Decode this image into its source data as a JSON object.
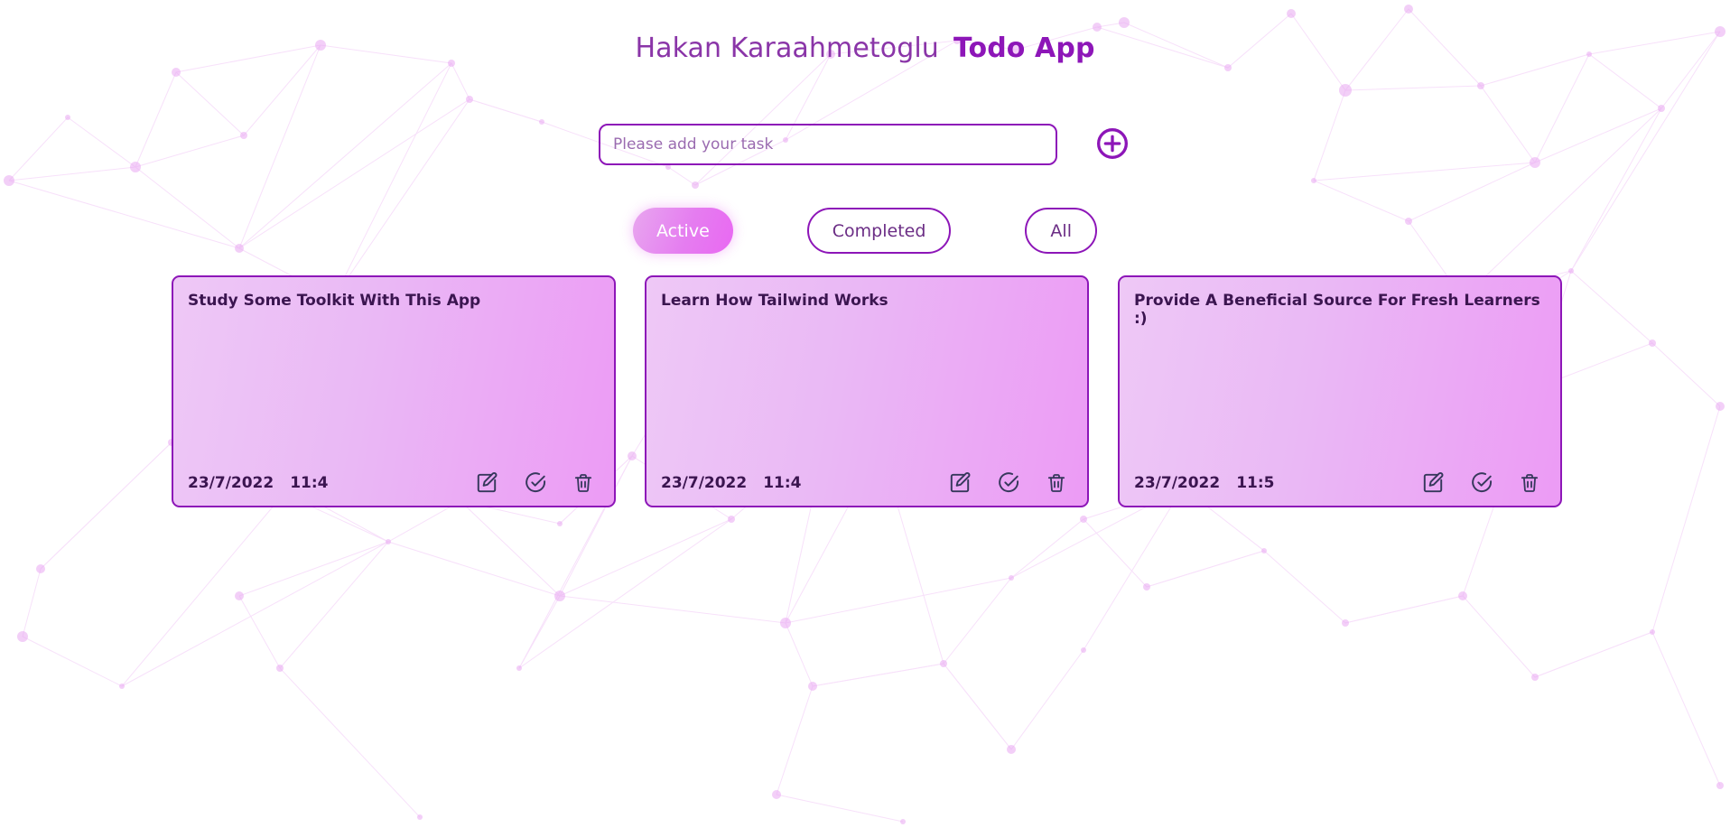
{
  "header": {
    "author": "Hakan Karaahmetoglu",
    "app_title": "Todo App"
  },
  "add_task": {
    "placeholder": "Please add your task",
    "value": "",
    "add_button_label": "add-task"
  },
  "filters": {
    "active_filter": "Active",
    "items": [
      {
        "label": "Active",
        "selected": true
      },
      {
        "label": "Completed",
        "selected": false
      },
      {
        "label": "All",
        "selected": false
      }
    ]
  },
  "todos": [
    {
      "title": "Study Some Toolkit With This App",
      "date": "23/7/2022",
      "time": "11:4"
    },
    {
      "title": "Learn How Tailwind Works",
      "date": "23/7/2022",
      "time": "11:4"
    },
    {
      "title": "Provide A Beneficial Source For Fresh Learners :)",
      "date": "23/7/2022",
      "time": "11:5"
    }
  ],
  "colors": {
    "brand_purple": "#8d16b8",
    "author_purple": "#8a35a8",
    "card_gradient_start": "#eec8f6",
    "card_gradient_end": "#ec9bf5",
    "card_text": "#3b1550",
    "icon_navy": "#36385c",
    "active_pill_start": "#e8a6ef",
    "active_pill_end": "#e968f2",
    "background": "#ffffff",
    "network_node": "#e9a8f2"
  },
  "icons": {
    "add": "plus-circle-icon",
    "edit": "edit-pencil-icon",
    "complete": "check-circle-icon",
    "delete": "trash-icon"
  }
}
